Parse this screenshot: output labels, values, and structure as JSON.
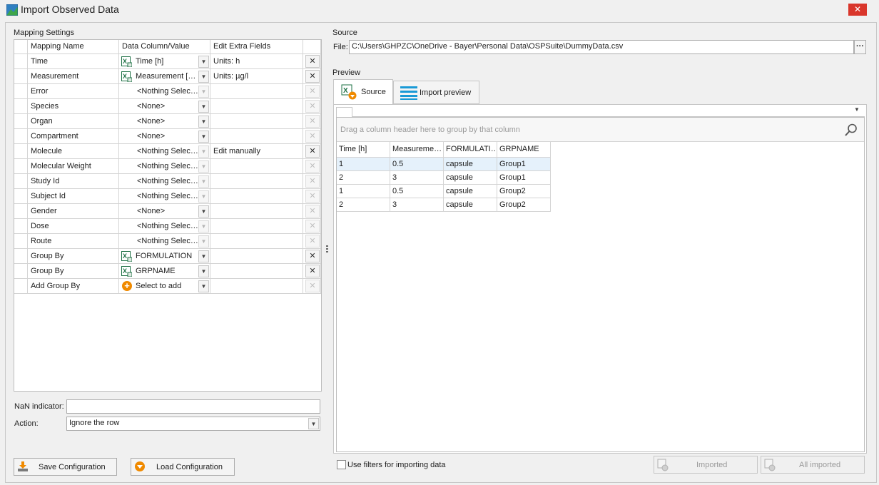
{
  "window": {
    "title": "Import Observed Data",
    "close_glyph": "✕"
  },
  "mapping": {
    "section_label": "Mapping Settings",
    "headers": [
      "Mapping Name",
      "Data Column/Value",
      "Edit Extra Fields"
    ],
    "rows": [
      {
        "name": "Time",
        "value": "Time [h]",
        "icon": "excel-column-icon",
        "extra": "Units: h",
        "remove_enabled": true
      },
      {
        "name": "Measurement",
        "value": "Measurement […",
        "icon": "excel-column-icon",
        "extra": "Units: µg/l",
        "remove_enabled": true
      },
      {
        "name": "Error",
        "value": "<Nothing Selec…",
        "icon": "",
        "extra": "",
        "remove_enabled": false
      },
      {
        "name": "Species",
        "value": "<None>",
        "icon": "",
        "extra": "",
        "remove_enabled": false
      },
      {
        "name": "Organ",
        "value": "<None>",
        "icon": "",
        "extra": "",
        "remove_enabled": false
      },
      {
        "name": "Compartment",
        "value": "<None>",
        "icon": "",
        "extra": "",
        "remove_enabled": false
      },
      {
        "name": "Molecule",
        "value": "<Nothing Selec…",
        "icon": "",
        "extra": "Edit manually",
        "remove_enabled": true
      },
      {
        "name": "Molecular Weight",
        "value": "<Nothing Selec…",
        "icon": "",
        "extra": "",
        "remove_enabled": false
      },
      {
        "name": "Study Id",
        "value": "<Nothing Selec…",
        "icon": "",
        "extra": "",
        "remove_enabled": false
      },
      {
        "name": "Subject Id",
        "value": "<Nothing Selec…",
        "icon": "",
        "extra": "",
        "remove_enabled": false
      },
      {
        "name": "Gender",
        "value": "<None>",
        "icon": "",
        "extra": "",
        "remove_enabled": false
      },
      {
        "name": "Dose",
        "value": "<Nothing Selec…",
        "icon": "",
        "extra": "",
        "remove_enabled": false
      },
      {
        "name": "Route",
        "value": "<Nothing Selec…",
        "icon": "",
        "extra": "",
        "remove_enabled": false
      },
      {
        "name": "Group By",
        "value": "FORMULATION",
        "icon": "excel-column-icon",
        "extra": "",
        "remove_enabled": true
      },
      {
        "name": "Group By",
        "value": "GRPNAME",
        "icon": "excel-column-icon",
        "extra": "",
        "remove_enabled": true
      },
      {
        "name": "Add Group By",
        "value": "Select to add",
        "icon": "add-icon",
        "extra": "",
        "remove_enabled": false
      }
    ],
    "nan_indicator_label": "NaN indicator:",
    "nan_indicator_value": "",
    "action_label": "Action:",
    "action_value": "Ignore the row"
  },
  "buttons": {
    "save_configuration": "Save Configuration",
    "load_configuration": "Load Configuration",
    "imported": "Imported",
    "all_imported": "All imported",
    "browse": "···"
  },
  "source": {
    "section_label": "Source",
    "file_label": "File:",
    "file_path": "C:\\Users\\GHPZC\\OneDrive - Bayer\\Personal Data\\OSPSuite\\DummyData.csv"
  },
  "preview": {
    "section_label": "Preview",
    "tabs": [
      "Source",
      "Import preview"
    ],
    "group_panel_hint": "Drag a column header here to group by that column",
    "columns": [
      "Time [h]",
      "Measureme…",
      "FORMULATI…",
      "GRPNAME"
    ],
    "rows": [
      [
        "1",
        "0.5",
        "capsule",
        "Group1"
      ],
      [
        "2",
        "3",
        "capsule",
        "Group1"
      ],
      [
        "1",
        "0.5",
        "capsule",
        "Group2"
      ],
      [
        "2",
        "3",
        "capsule",
        "Group2"
      ]
    ],
    "use_filters_label": "Use filters for importing data",
    "use_filters_checked": false
  },
  "colors": {
    "accent_orange": "#f08a00",
    "excel_green": "#1e7145",
    "selection": "#e5f1fb",
    "close_red": "#d9362b"
  }
}
